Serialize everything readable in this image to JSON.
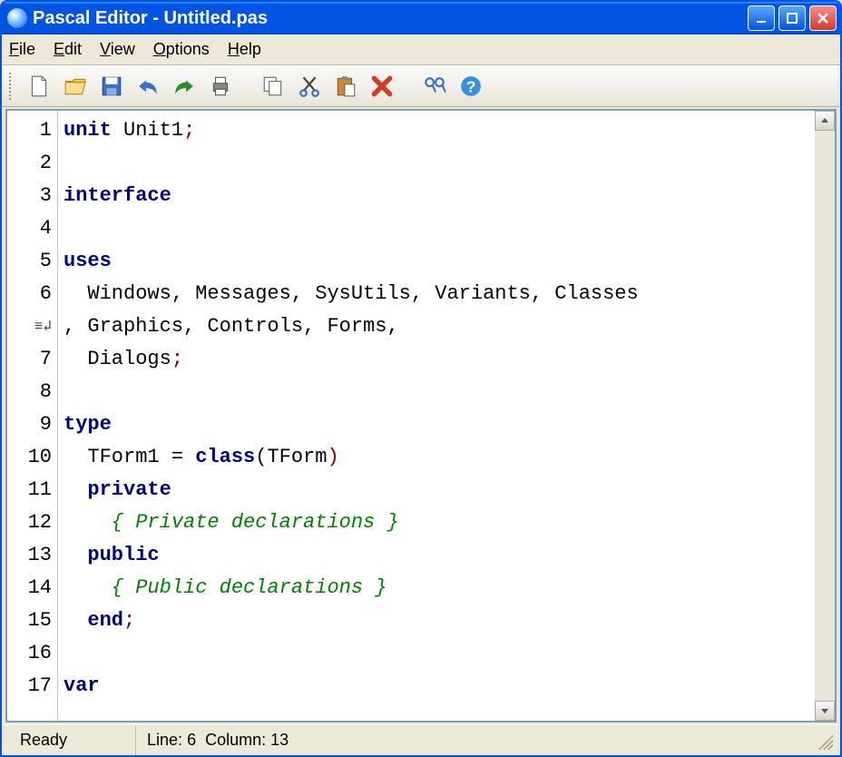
{
  "window": {
    "title": "Pascal Editor - Untitled.pas"
  },
  "menu": {
    "file": "File",
    "edit": "Edit",
    "view": "View",
    "options": "Options",
    "help": "Help"
  },
  "toolbar_icons": {
    "new": "new-file-icon",
    "open": "open-folder-icon",
    "save": "save-icon",
    "undo": "undo-icon",
    "redo": "redo-icon",
    "print": "print-icon",
    "copy": "copy-icon",
    "cut": "cut-icon",
    "paste": "paste-icon",
    "delete": "delete-icon",
    "find": "find-icon",
    "help": "help-icon"
  },
  "gutter": {
    "lines": [
      "1",
      "2",
      "3",
      "4",
      "5",
      "6",
      "",
      "7",
      "8",
      "9",
      "10",
      "11",
      "12",
      "13",
      "14",
      "15",
      "16",
      "17"
    ],
    "wrap_marker": "≡↲"
  },
  "code": {
    "l1_kw": "unit",
    "l1_rest": " Unit1",
    "l1_p": ";",
    "l3_kw": "interface",
    "l5_kw": "uses",
    "l6": "  Windows, Messages, SysUtils, Variants, Classes",
    "l6b": ", Graphics, Controls, Forms,",
    "l7": "  Dialogs",
    "l7_p": ";",
    "l9_kw": "type",
    "l10a": "  TForm1 = ",
    "l10_kw": "class",
    "l10b": "(TForm",
    "l10_p": ")",
    "l11_kw": "  private",
    "l12_cmt": "    { Private declarations }",
    "l13_kw": "  public",
    "l14_cmt": "    { Public declarations }",
    "l15_kw": "  end",
    "l15_p": ";",
    "l17_kw": "var"
  },
  "status": {
    "ready": "Ready",
    "line_label": "Line:",
    "line_val": "6",
    "col_label": "Column:",
    "col_val": "13"
  }
}
